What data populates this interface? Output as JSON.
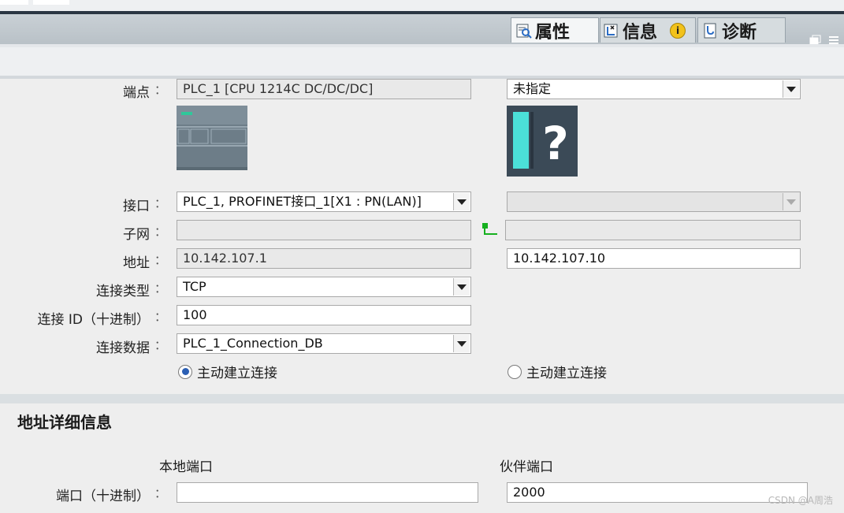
{
  "tabs": [
    {
      "label": "属性",
      "icon": "properties-icon",
      "active": true
    },
    {
      "label": "信息",
      "icon": "info-icon",
      "active": false
    },
    {
      "label": "诊断",
      "icon": "diagnostics-icon",
      "active": false
    }
  ],
  "connection": {
    "endpoint": {
      "label": "端点",
      "local": "PLC_1 [CPU 1214C DC/DC/DC]",
      "partner": "未指定"
    },
    "interface": {
      "label": "接口",
      "local": "PLC_1, PROFINET接口_1[X1 : PN(LAN)]",
      "partner": ""
    },
    "subnet": {
      "label": "子网",
      "local": "",
      "partner": ""
    },
    "address": {
      "label": "地址",
      "local": "10.142.107.1",
      "partner": "10.142.107.10"
    },
    "connection_type": {
      "label": "连接类型",
      "value": "TCP"
    },
    "connection_id": {
      "label": "连接 ID（十进制）",
      "value": "100"
    },
    "connection_data": {
      "label": "连接数据",
      "value": "PLC_1_Connection_DB"
    },
    "active_local": {
      "label": "主动建立连接",
      "checked": true
    },
    "active_partner": {
      "label": "主动建立连接",
      "checked": false
    },
    "colon": "："
  },
  "address_details": {
    "title": "地址详细信息",
    "local_header": "本地端口",
    "partner_header": "伙伴端口",
    "port_label": "端口（十进制）",
    "local_port": "",
    "partner_port": "2000"
  },
  "info_badge": "i",
  "watermark": "CSDN @A周浩"
}
